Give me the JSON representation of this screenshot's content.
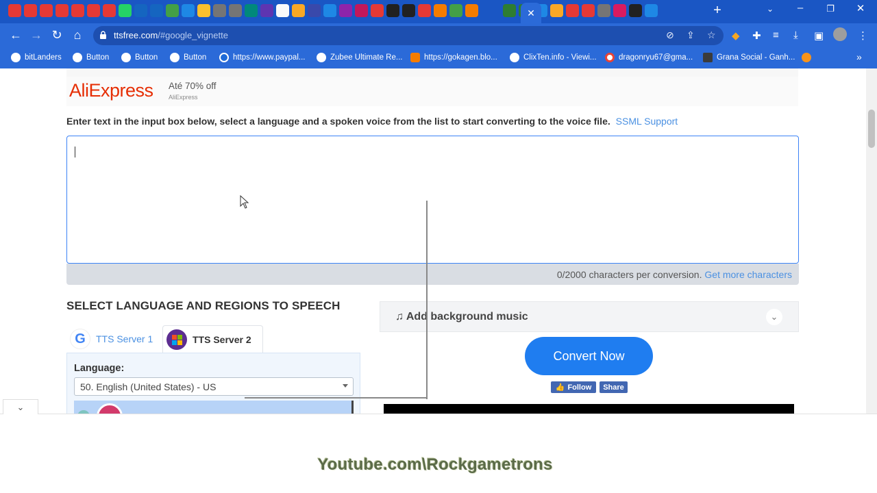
{
  "browser": {
    "url_host": "ttsfree.com",
    "url_path": "/#google_vignette",
    "bookmarks": [
      {
        "label": "bitLanders"
      },
      {
        "label": "Button"
      },
      {
        "label": "Button"
      },
      {
        "label": "Button"
      },
      {
        "label": "https://www.paypal..."
      },
      {
        "label": "Zubee Ultimate Re..."
      },
      {
        "label": "https://gokagen.blo..."
      },
      {
        "label": "ClixTen.info - Viewi..."
      },
      {
        "label": "dragonryu67@gma..."
      },
      {
        "label": "Grana Social - Ganh..."
      }
    ],
    "tab_icons": [
      "#e53935",
      "#e53935",
      "#e53935",
      "#e53935",
      "#e53935",
      "#e53935",
      "#e53935",
      "#25d366",
      "#1565c0",
      "#1565c0",
      "#43a047",
      "#1e88e5",
      "#fbc02d",
      "#757575",
      "#757575",
      "#00897b",
      "#5e35b1",
      "#fafafa",
      "#f9a825",
      "#3949ab",
      "#1e88e5",
      "#8e24aa",
      "#c2185b",
      "#e53935",
      "#212121",
      "#212121",
      "#e53935",
      "#f57c00",
      "#43a047",
      "#f57c00",
      "#2e7d32",
      "#2e7d32",
      "#1e88e5",
      "#f9a825",
      "#e53935",
      "#e53935",
      "#757575",
      "#d81b60",
      "#212121",
      "#1e88e5"
    ]
  },
  "ad": {
    "brand": "AliExpress",
    "text": "Até 70% off",
    "sub": "AliExpress"
  },
  "intro": {
    "text": "Enter text in the input box below, select a language and a spoken voice from the list to start converting to the voice file.",
    "link": "SSML Support"
  },
  "counter": {
    "text": "0/2000 characters per conversion.",
    "link": "Get more characters"
  },
  "section": {
    "title": "SELECT LANGUAGE AND REGIONS TO SPEECH"
  },
  "tabs": {
    "server1": "TTS Server 1",
    "server2": "TTS Server 2"
  },
  "language": {
    "label": "Language:",
    "selected": "50. English (United States) - US"
  },
  "music": {
    "title": "Add background music"
  },
  "convert": {
    "label": "Convert Now"
  },
  "social": {
    "follow": "Follow",
    "share": "Share"
  },
  "watermark": {
    "text": "Youtube.com\\Rockgametrons"
  }
}
